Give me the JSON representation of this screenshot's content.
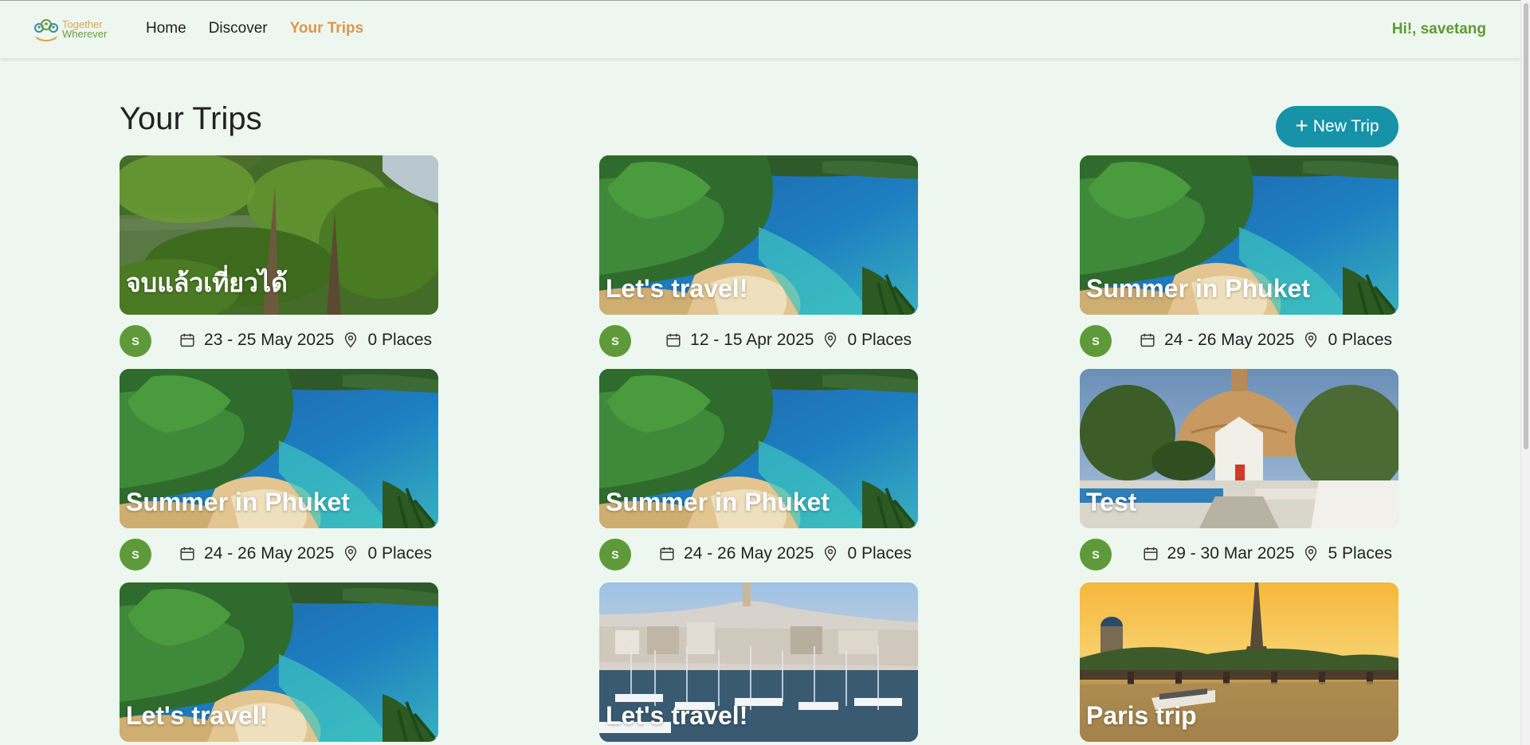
{
  "nav": {
    "logo_line1": "Together",
    "logo_line2": "Wherever",
    "links": [
      "Home",
      "Discover",
      "Your Trips"
    ],
    "greeting": "Hi!, savetang"
  },
  "page": {
    "title": "Your Trips",
    "new_trip_label": "New Trip"
  },
  "trips": [
    {
      "title": "จบแล้วเที่ยวได้",
      "dates": "23 - 25 May 2025",
      "places": "0 Places",
      "avatar": "S",
      "image": "garden"
    },
    {
      "title": "Let's travel!",
      "dates": "12 - 15 Apr 2025",
      "places": "0 Places",
      "avatar": "S",
      "image": "beach"
    },
    {
      "title": "Summer in Phuket",
      "dates": "24 - 26 May 2025",
      "places": "0 Places",
      "avatar": "S",
      "image": "beach"
    },
    {
      "title": "Summer in Phuket",
      "dates": "24 - 26 May 2025",
      "places": "0 Places",
      "avatar": "S",
      "image": "beach"
    },
    {
      "title": "Summer in Phuket",
      "dates": "24 - 26 May 2025",
      "places": "0 Places",
      "avatar": "S",
      "image": "beach"
    },
    {
      "title": "Test",
      "dates": "29 - 30 Mar 2025",
      "places": "5 Places",
      "avatar": "S",
      "image": "temple"
    },
    {
      "title": "Let's travel!",
      "dates": "",
      "places": "",
      "avatar": "",
      "image": "beach"
    },
    {
      "title": "Let's travel!",
      "dates": "",
      "places": "",
      "avatar": "",
      "image": "harbor"
    },
    {
      "title": "Paris trip",
      "dates": "",
      "places": "",
      "avatar": "",
      "image": "paris"
    }
  ],
  "colors": {
    "background": "#eef7ef",
    "accent_orange": "#e0964a",
    "accent_green": "#5e9a33",
    "button_teal": "#1693a8"
  }
}
